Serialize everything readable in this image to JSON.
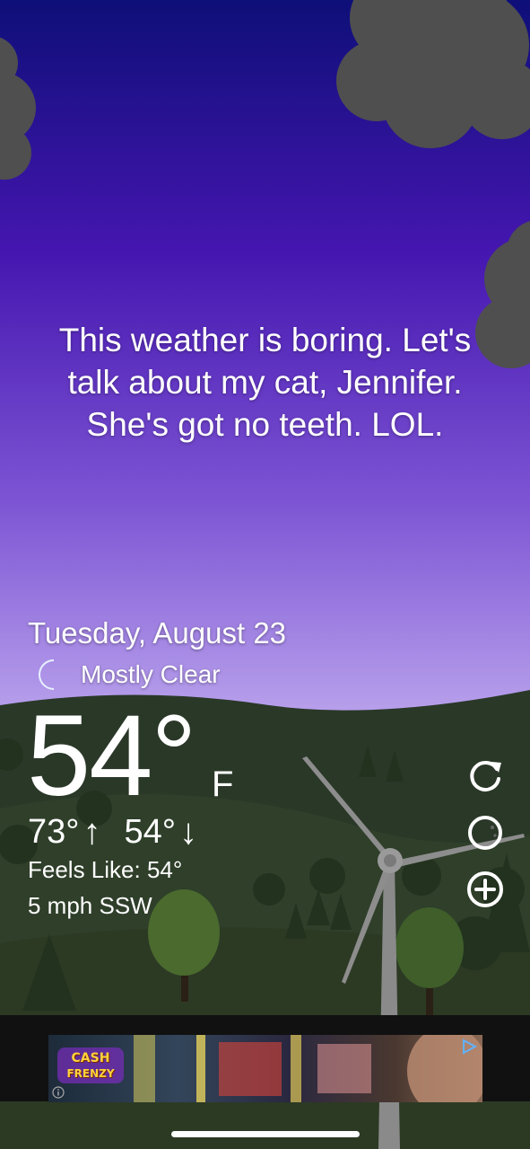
{
  "message": {
    "line1": "This weather is boring. Let's",
    "line2": "talk about my cat, Jennifer.",
    "line3": "She's got no teeth. LOL."
  },
  "weather": {
    "date": "Tuesday, August 23",
    "condition": "Mostly Clear",
    "condition_icon": "moon-icon",
    "temperature": "54°",
    "unit": "F",
    "high": "73°",
    "high_arrow": "↑",
    "low": "54°",
    "low_arrow": "↓",
    "feels_like": "Feels Like: 54°",
    "wind": "5 mph SSW"
  },
  "actions": {
    "refresh": "refresh-icon",
    "theme": "moon-phase-icon",
    "add": "add-location-icon"
  },
  "ad": {
    "logo_line1": "CASH",
    "logo_line2": "FRENZY"
  },
  "colors": {
    "sky_top": "#0e0f78",
    "sky_mid": "#5a2bc0",
    "sky_bottom": "#b9a2ec",
    "hills": "#2b3a28",
    "accent_moon": "#2f7be8"
  }
}
